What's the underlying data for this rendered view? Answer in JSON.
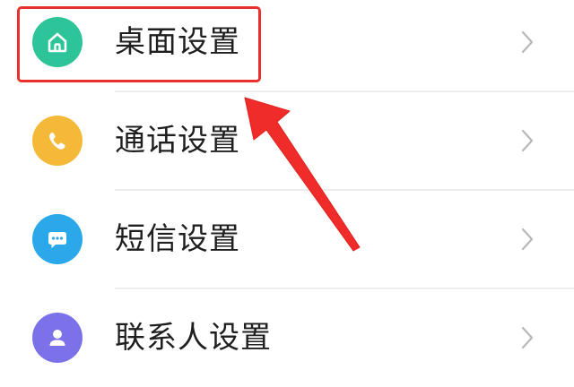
{
  "settings": {
    "items": [
      {
        "label": "桌面设置",
        "icon": "home-icon",
        "color": "#2ec49a"
      },
      {
        "label": "通话设置",
        "icon": "phone-icon",
        "color": "#f5b93a"
      },
      {
        "label": "短信设置",
        "icon": "message-icon",
        "color": "#2aa8ea"
      },
      {
        "label": "联系人设置",
        "icon": "person-icon",
        "color": "#7b72ea"
      }
    ]
  },
  "annotation": {
    "highlight_color": "#e8312f",
    "highlighted_item": "桌面设置"
  }
}
